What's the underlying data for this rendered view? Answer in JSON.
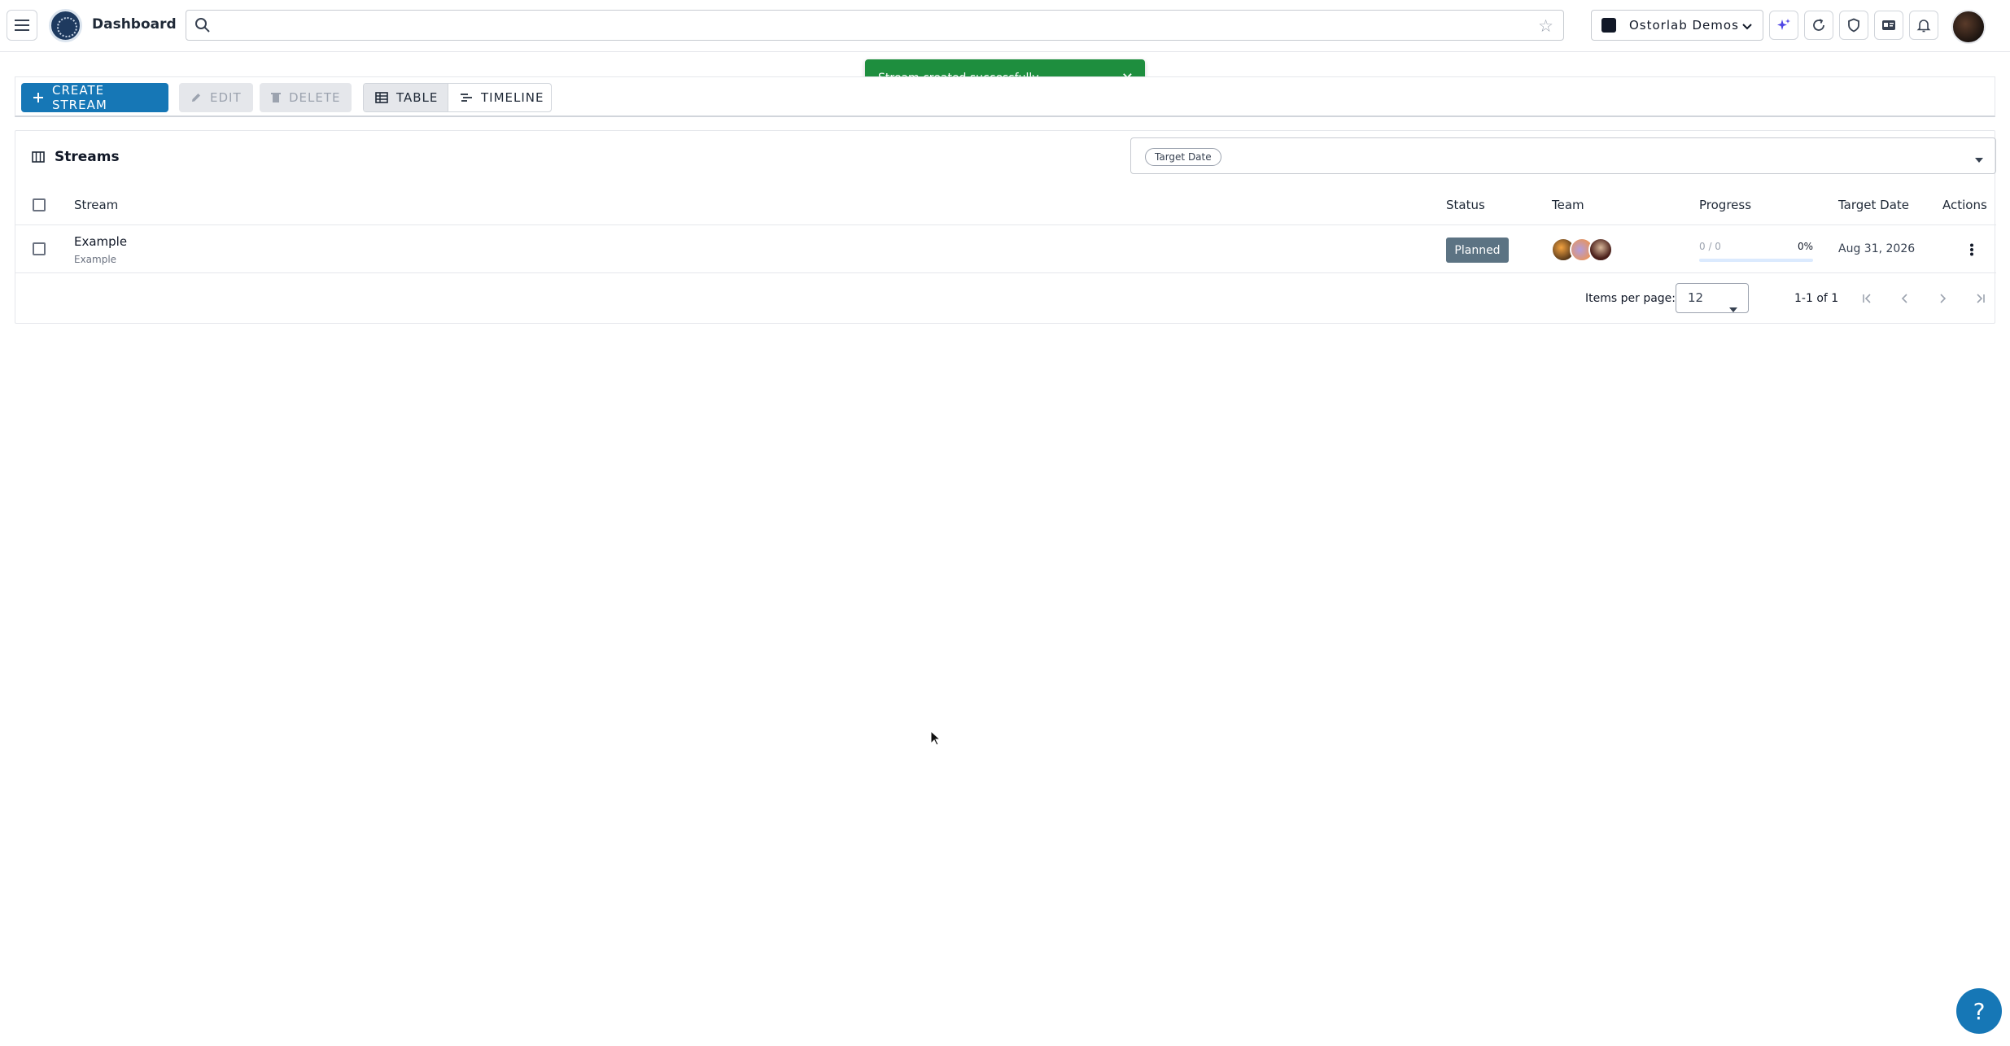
{
  "topbar": {
    "brand": "Dashboard",
    "search_value": "",
    "org_name": "Ostorlab Demos"
  },
  "toast": {
    "message": "Stream created successfully"
  },
  "toolbar": {
    "create_label": "CREATE STREAM",
    "edit_label": "EDIT",
    "delete_label": "DELETE",
    "table_label": "TABLE",
    "timeline_label": "TIMELINE"
  },
  "streams": {
    "title": "Streams",
    "filter_chip": "Target Date",
    "columns": {
      "stream": "Stream",
      "status": "Status",
      "team": "Team",
      "progress": "Progress",
      "target_date": "Target Date",
      "actions": "Actions"
    },
    "rows": [
      {
        "name": "Example",
        "subtitle": "Example",
        "status": "Planned",
        "progress_count": "0 / 0",
        "progress_pct": "0%",
        "progress_fraction": 0,
        "target_date": "Aug 31, 2026"
      }
    ]
  },
  "pagination": {
    "items_per_page_label": "Items per page:",
    "items_per_page_value": "12",
    "range": "1-1 of 1"
  },
  "help": {
    "label": "?"
  },
  "colors": {
    "primary": "#1677b6",
    "toast_success": "#1e8e3e",
    "status_planned": "#5c7383"
  }
}
